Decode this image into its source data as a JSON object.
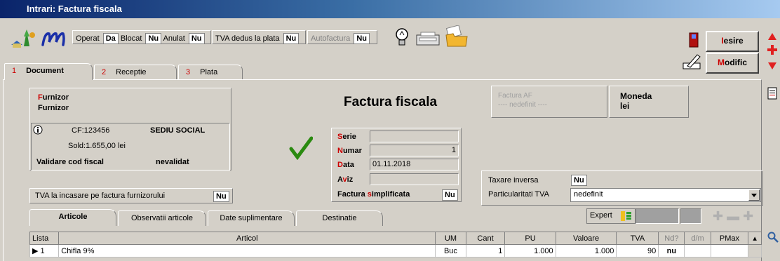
{
  "window": {
    "title": "Intrari: Factura fiscala"
  },
  "toolbar": {
    "operat_label": "Operat",
    "operat_value": "Da",
    "blocat_label": "Blocat",
    "blocat_value": "Nu",
    "anulat_label": "Anulat",
    "anulat_value": "Nu",
    "tva_dedus_label": "TVA dedus la plata",
    "tva_dedus_value": "Nu",
    "autofactura_label": "Autofactura",
    "autofactura_value": "Nu",
    "iesire_label": "Iesire",
    "modific_label": "Modific"
  },
  "tabs": [
    {
      "num": "1",
      "label": "Document"
    },
    {
      "num": "2",
      "label": "Receptie"
    },
    {
      "num": "3",
      "label": "Plata"
    }
  ],
  "supplier": {
    "label": "Furnizor",
    "name": "Furnizor",
    "cf": "CF:123456",
    "sediu": "SEDIU SOCIAL",
    "sold": "Sold:1.655,00 lei",
    "validare_label": "Validare cod fiscal",
    "validare_value": "nevalidat"
  },
  "tva_incasare": {
    "label": "TVA la incasare pe factura furnizorului",
    "value": "Nu"
  },
  "document": {
    "heading": "Factura fiscala",
    "serie_label": "Serie",
    "serie_value": "",
    "numar_label": "Numar",
    "numar_value": "1",
    "data_label": "Data",
    "data_value": "01.11.2018",
    "aviz_label": "Aviz",
    "aviz_value": "",
    "simplificata_label": "Factura simplificata",
    "simplificata_value": "Nu"
  },
  "factura_af": {
    "label": "Factura AF",
    "value": "---- nedefinit ----"
  },
  "moneda": {
    "label": "Moneda",
    "value": "lei"
  },
  "taxare": {
    "label": "Taxare inversa",
    "value": "Nu"
  },
  "particularitati": {
    "label": "Particularitati TVA",
    "value": "nedefinit"
  },
  "grid_tabs": [
    "Articole",
    "Observatii articole",
    "Date suplimentare",
    "Destinatie"
  ],
  "expert_label": "Expert",
  "grid": {
    "columns": [
      "Lista",
      "Articol",
      "UM",
      "Cant",
      "PU",
      "Valoare",
      "TVA",
      "Nd?",
      "d/m",
      "PMax"
    ],
    "rows": [
      {
        "nr": "1",
        "articol": "Chifla 9%",
        "um": "Buc",
        "cant": "1",
        "pu": "1.000",
        "valoare": "1.000",
        "tva": "90",
        "nd": "nu",
        "dm": "",
        "pmax": ""
      }
    ]
  }
}
